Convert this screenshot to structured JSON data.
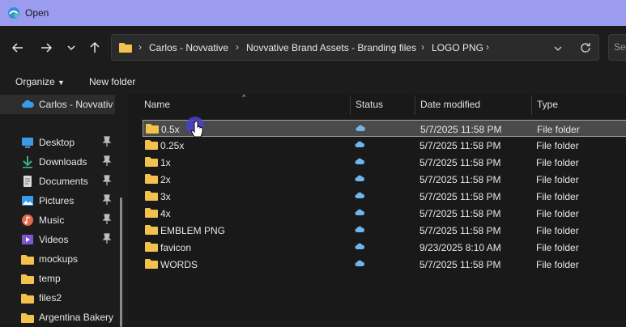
{
  "window": {
    "title": "Open"
  },
  "address": {
    "crumbs": [
      "Carlos - Novvative",
      "Novvative Brand Assets - Branding files",
      "LOGO PNG"
    ],
    "search_placeholder": "Se"
  },
  "toolbar": {
    "organize": "Organize",
    "new_folder": "New folder"
  },
  "sidebar": {
    "top": "Carlos - Novvativ",
    "items": [
      {
        "label": "Desktop",
        "icon": "desktop-icon",
        "pinned": true
      },
      {
        "label": "Downloads",
        "icon": "download-icon",
        "pinned": true
      },
      {
        "label": "Documents",
        "icon": "documents-icon",
        "pinned": true
      },
      {
        "label": "Pictures",
        "icon": "pictures-icon",
        "pinned": true
      },
      {
        "label": "Music",
        "icon": "music-icon",
        "pinned": true
      },
      {
        "label": "Videos",
        "icon": "videos-icon",
        "pinned": true
      },
      {
        "label": "mockups",
        "icon": "folder-icon",
        "pinned": false
      },
      {
        "label": "temp",
        "icon": "folder-icon",
        "pinned": false
      },
      {
        "label": "files2",
        "icon": "folder-icon",
        "pinned": false
      },
      {
        "label": "Argentina Bakery",
        "icon": "folder-icon",
        "pinned": false
      }
    ]
  },
  "columns": {
    "name": "Name",
    "status": "Status",
    "date": "Date modified",
    "type": "Type"
  },
  "files": [
    {
      "name": "0.5x",
      "date": "5/7/2025 11:58 PM",
      "type": "File folder",
      "selected": true
    },
    {
      "name": "0.25x",
      "date": "5/7/2025 11:58 PM",
      "type": "File folder"
    },
    {
      "name": "1x",
      "date": "5/7/2025 11:58 PM",
      "type": "File folder"
    },
    {
      "name": "2x",
      "date": "5/7/2025 11:58 PM",
      "type": "File folder"
    },
    {
      "name": "3x",
      "date": "5/7/2025 11:58 PM",
      "type": "File folder"
    },
    {
      "name": "4x",
      "date": "5/7/2025 11:58 PM",
      "type": "File folder"
    },
    {
      "name": "EMBLEM PNG",
      "date": "5/7/2025 11:58 PM",
      "type": "File folder"
    },
    {
      "name": "favicon",
      "date": "9/23/2025 8:10 AM",
      "type": "File folder"
    },
    {
      "name": "WORDS",
      "date": "5/7/2025 11:58 PM",
      "type": "File folder"
    }
  ],
  "colors": {
    "titlebar": "#9b9bf0",
    "folder": "#f2c14e",
    "cloud": "#6fb6ee",
    "accent": "#4a3fd0"
  }
}
